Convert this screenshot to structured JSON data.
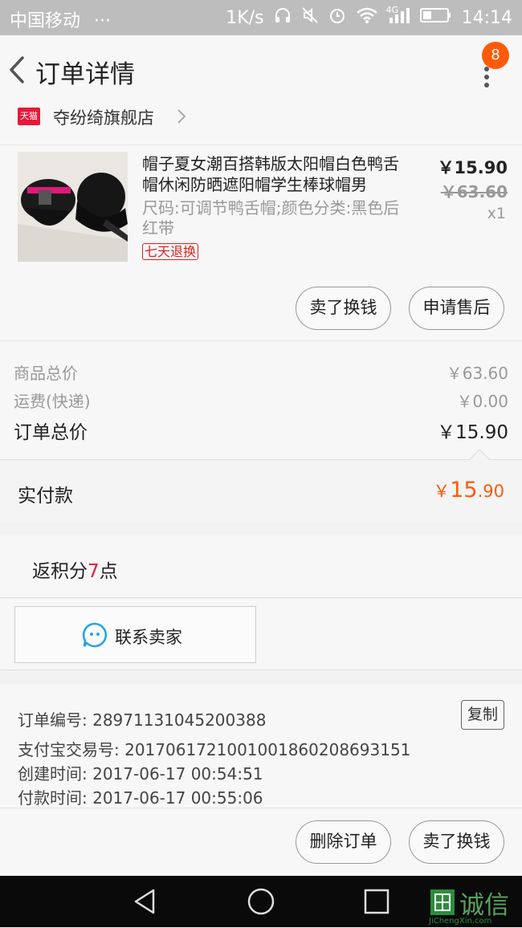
{
  "status_bar": {
    "carrier": "中国移动",
    "dots": "···",
    "speed": "1K/s",
    "network": "4G",
    "time": "14:14",
    "icons": [
      "headphones-icon",
      "mute-icon",
      "alarm-icon",
      "wifi-icon",
      "signal-icon",
      "battery-icon"
    ]
  },
  "nav": {
    "title": "订单详情",
    "badge": "8"
  },
  "shop": {
    "tag": "天猫",
    "name": "夺纷绮旗舰店"
  },
  "product": {
    "title": "帽子夏女潮百搭韩版太阳帽白色鸭舌帽休闲防晒遮阳帽学生棒球帽男",
    "sku": "尺码:可调节鸭舌帽;颜色分类:黑色后红带",
    "tag": "七天退换",
    "price": "￥15.90",
    "original_price": "￥63.60",
    "quantity": "x1",
    "buttons": [
      "卖了换钱",
      "申请售后"
    ]
  },
  "summary": {
    "goods_label": "商品总价",
    "goods_value": "￥63.60",
    "shipping_label": "运费(快递)",
    "shipping_value": "￥0.00",
    "total_label": "订单总价",
    "total_value": "￥15.90"
  },
  "paid": {
    "label": "实付款",
    "currency": "￥",
    "integer": "15",
    "decimal": ".90"
  },
  "points": {
    "prefix": "返积分",
    "value": "7",
    "suffix": "点"
  },
  "contact": {
    "label": "联系卖家"
  },
  "order_info": {
    "order_no_label": "订单编号: ",
    "order_no": "28971131045200388",
    "copy_label": "复制",
    "alipay_label": "支付宝交易号: ",
    "alipay_no": "2017061721001001860208693151",
    "created_label": "创建时间: ",
    "created": "2017-06-17 00:54:51",
    "paid_label": "付款时间: ",
    "paid_time": "2017-06-17 00:55:06"
  },
  "bottom_actions": [
    "删除订单",
    "卖了换钱"
  ],
  "watermark": {
    "text": "诚信",
    "sub": "JiChengXin.com"
  },
  "colors": {
    "accent": "#ff5a0a",
    "tmall": "#e6183a",
    "points_red": "#e6183a"
  }
}
